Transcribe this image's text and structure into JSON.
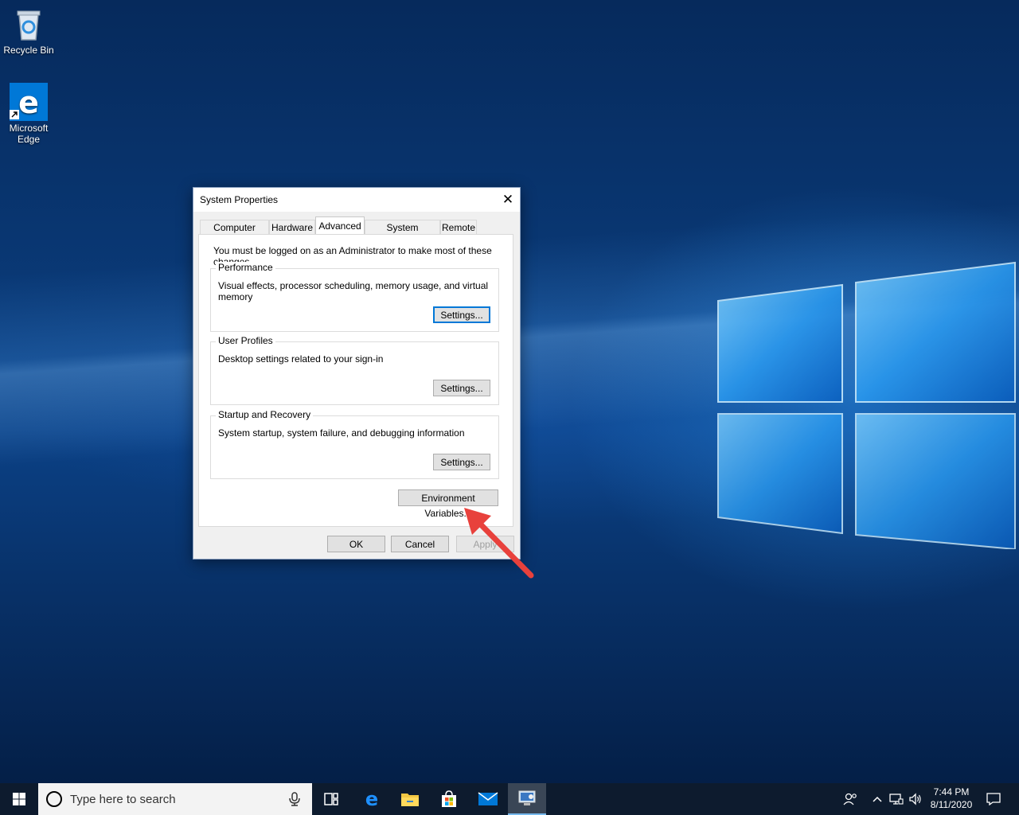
{
  "desktop": {
    "icons": [
      {
        "label": "Recycle Bin",
        "icon": "recycle-bin-icon"
      },
      {
        "label": "Microsoft Edge",
        "icon": "edge-icon"
      }
    ]
  },
  "dialog": {
    "title": "System Properties",
    "close_label": "✕",
    "tabs": [
      {
        "label": "Computer Name"
      },
      {
        "label": "Hardware"
      },
      {
        "label": "Advanced"
      },
      {
        "label": "System Protection"
      },
      {
        "label": "Remote"
      }
    ],
    "active_tab": "Advanced",
    "notice": "You must be logged on as an Administrator to make most of these changes.",
    "groups": [
      {
        "legend": "Performance",
        "description": "Visual effects, processor scheduling, memory usage, and virtual memory",
        "button": "Settings..."
      },
      {
        "legend": "User Profiles",
        "description": "Desktop settings related to your sign-in",
        "button": "Settings..."
      },
      {
        "legend": "Startup and Recovery",
        "description": "System startup, system failure, and debugging information",
        "button": "Settings..."
      }
    ],
    "env_button": "Environment Variables...",
    "footer": {
      "ok": "OK",
      "cancel": "Cancel",
      "apply": "Apply"
    }
  },
  "annotation": {
    "color": "#e8413c",
    "target": "Environment Variables..."
  },
  "taskbar": {
    "search_placeholder": "Type here to search",
    "apps": [
      "task-view-icon",
      "edge-icon",
      "file-explorer-icon",
      "store-icon",
      "mail-icon",
      "system-properties-icon"
    ],
    "tray": [
      "people-icon",
      "chevron-up-icon",
      "network-icon",
      "volume-icon"
    ],
    "time": "7:44 PM",
    "date": "8/11/2020",
    "notifications_icon": "action-center-icon"
  },
  "colors": {
    "accent": "#0078d7",
    "taskbar": "#0d1b2e"
  }
}
